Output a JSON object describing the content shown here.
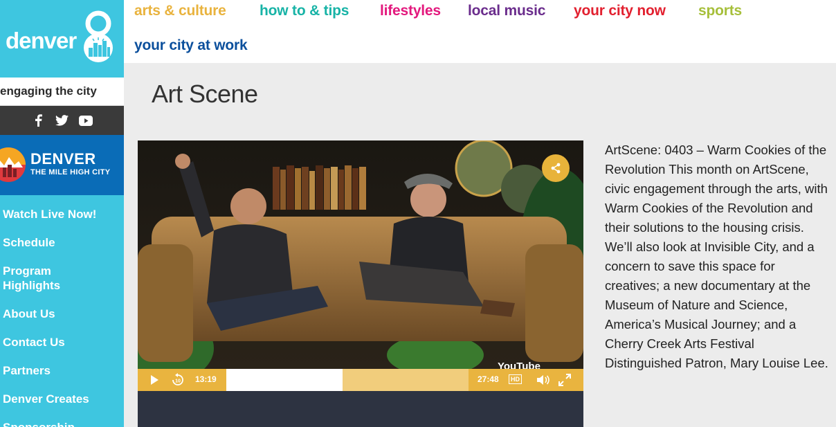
{
  "logo": {
    "text": "denver",
    "digit": "8"
  },
  "tagline": "engaging the city",
  "social": {
    "icons": [
      "facebook-icon",
      "twitter-icon",
      "youtube-icon"
    ]
  },
  "badge": {
    "title": "DENVER",
    "subtitle": "THE MILE HIGH CITY"
  },
  "sidebar": {
    "items": [
      {
        "label": "Watch Live Now!"
      },
      {
        "label": "Schedule"
      },
      {
        "label": "Program Highlights"
      },
      {
        "label": "About Us"
      },
      {
        "label": "Contact Us"
      },
      {
        "label": "Partners"
      },
      {
        "label": "Denver Creates"
      },
      {
        "label": "Sponsorship"
      }
    ]
  },
  "topnav": {
    "items": [
      {
        "label": "arts & culture",
        "color": "#e9b33e"
      },
      {
        "label": "how to & tips",
        "color": "#17b3a6"
      },
      {
        "label": "lifestyles",
        "color": "#e3187d"
      },
      {
        "label": "local music",
        "color": "#6a2c8c"
      },
      {
        "label": "your city now",
        "color": "#e2202f"
      },
      {
        "label": "sports",
        "color": "#a6bf3a"
      },
      {
        "label": "your city at work",
        "color": "#0b4f9c"
      }
    ]
  },
  "main": {
    "title": "Art Scene",
    "description": "ArtScene: 0403 – Warm Cookies of the Revolution This month on ArtScene, civic engagement through the arts, with Warm Cookies of the Revolution and their solutions to the housing crisis. We’ll also look at Invisible City, and a concern to save this space for creatives; a new documentary at the Museum of Nature and Science, America’s Musical Journey; and a Cherry Creek Arts Festival Distinguished Patron, Mary Louise Lee."
  },
  "player": {
    "current_time": "13:19",
    "duration": "27:48",
    "quality": "HD",
    "played_fraction": 0.48,
    "watermark": "YouTube",
    "accent": "#e9b43f"
  }
}
